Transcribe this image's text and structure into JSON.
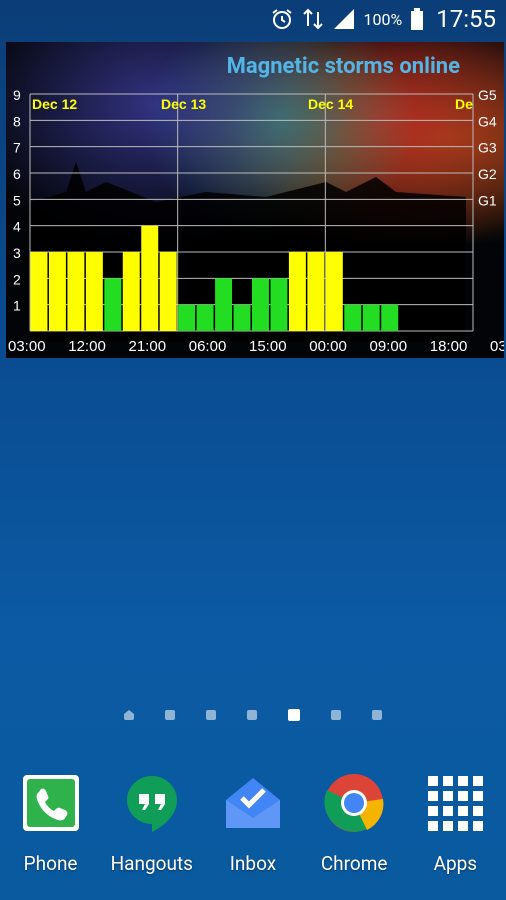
{
  "status_bar": {
    "battery_percent": "100%",
    "time": "17:55",
    "icons": [
      "alarm-clock-icon",
      "data-transfer-icon",
      "signal-icon",
      "battery-icon"
    ]
  },
  "widget": {
    "title": "Magnetic storms online"
  },
  "chart_data": {
    "type": "bar",
    "y_ticks": [
      "9",
      "8",
      "7",
      "6",
      "5",
      "4",
      "3",
      "2",
      "1"
    ],
    "y_right_labels": [
      "G5",
      "G4",
      "G3",
      "G2",
      "G1"
    ],
    "day_labels": [
      "Dec 12",
      "Dec 13",
      "Dec 14",
      "De"
    ],
    "x_tick_labels": [
      "03:00",
      "12:00",
      "21:00",
      "06:00",
      "15:00",
      "00:00",
      "09:00",
      "18:00",
      "03:00"
    ],
    "ylim": [
      0,
      9
    ],
    "values": [
      3,
      3,
      3,
      3,
      2,
      3,
      4,
      3,
      1,
      1,
      2,
      1,
      2,
      2,
      3,
      3,
      3,
      1,
      1,
      1
    ],
    "colors": {
      "yellow": "#ffff00",
      "green": "#22dd22"
    }
  },
  "home_dots": [
    "home",
    "",
    "",
    "",
    "active",
    "",
    ""
  ],
  "dock": [
    {
      "label": "Phone",
      "icon": "phone-icon"
    },
    {
      "label": "Hangouts",
      "icon": "hangouts-icon"
    },
    {
      "label": "Inbox",
      "icon": "inbox-icon"
    },
    {
      "label": "Chrome",
      "icon": "chrome-icon"
    },
    {
      "label": "Apps",
      "icon": "apps-grid-icon"
    }
  ]
}
